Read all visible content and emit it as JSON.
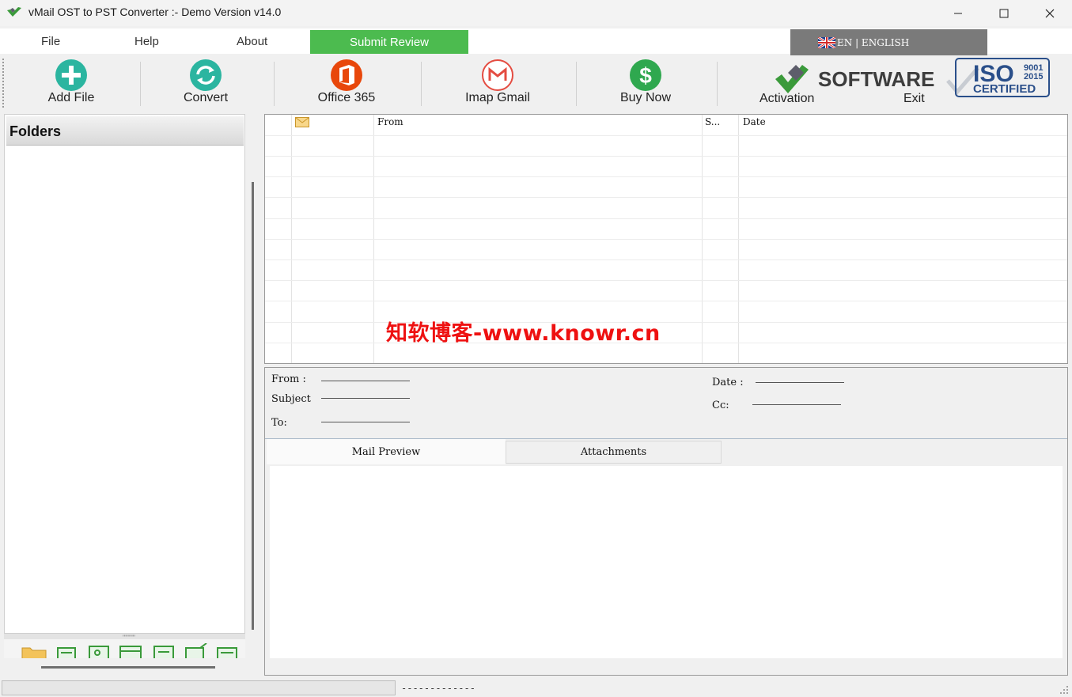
{
  "window": {
    "title": "vMail OST to PST Converter :- Demo Version v14.0",
    "controls": [
      "minimize-icon",
      "maximize-icon",
      "close-icon"
    ]
  },
  "menu": {
    "file": "File",
    "help": "Help",
    "about": "About",
    "submit_review": "Submit Review",
    "language": "EN  |  ENGLISH"
  },
  "toolbar": {
    "add_file": "Add File",
    "convert": "Convert",
    "office365": "Office 365",
    "imap_gmail": "Imap Gmail",
    "buy_now": "Buy Now",
    "activation": "Activation",
    "exit": "Exit"
  },
  "branding": {
    "software": "SOFTWARE",
    "iso": "ISO",
    "iso_years": [
      "9001",
      "2015"
    ],
    "certified": "CERTIFIED"
  },
  "folders": {
    "title": "Folders",
    "splitter_dots": "\"\"\"\"\"",
    "nav_icons": [
      "folder-icon",
      "mail-icon",
      "contacts-icon",
      "calendar-icon",
      "tasks-icon",
      "notes-icon",
      "journal-icon"
    ]
  },
  "grid": {
    "columns": [
      "",
      "",
      "From",
      "S...",
      "Date"
    ],
    "rows": []
  },
  "details": {
    "from_label": "From :",
    "subject_label": "Subject",
    "to_label": "To:",
    "date_label": "Date :",
    "cc_label": "Cc:"
  },
  "tabs": {
    "mail_preview": "Mail Preview",
    "attachments": "Attachments"
  },
  "status": {
    "text": "-------------"
  },
  "watermark": "知软博客-www.knowr.cn",
  "colors": {
    "submit_review": "#4cbb4f",
    "language_bg": "#7a7a7a",
    "add_file": "#2bb5a0",
    "convert": "#2bb5a0",
    "office365": "#e8470b",
    "gmail": "#e44c41",
    "buy_now": "#2fa84f",
    "watermark": "#ee1111"
  }
}
